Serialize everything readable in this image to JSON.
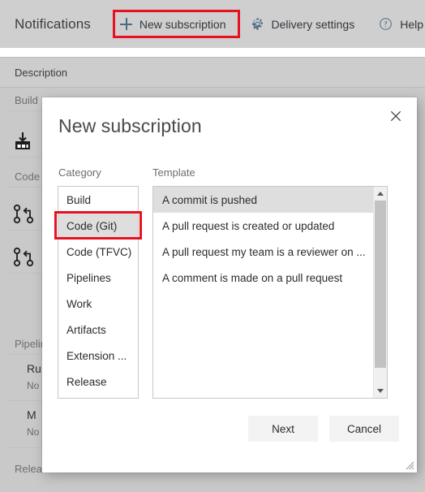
{
  "background": {
    "toolbar": {
      "title": "Notifications",
      "items": [
        {
          "label": "New subscription",
          "icon": "plus-icon",
          "highlighted": true
        },
        {
          "label": "Delivery settings",
          "icon": "gear-icon",
          "highlighted": false
        },
        {
          "label": "Help",
          "icon": "help-circle-icon",
          "highlighted": false
        }
      ]
    },
    "column_header": "Description",
    "groups": [
      {
        "label": "Build"
      },
      {
        "label": "Code"
      },
      {
        "label": "Pipelines"
      },
      {
        "label": "Release"
      }
    ],
    "rows": [
      {
        "primary": "Ru",
        "secondary": "No"
      },
      {
        "primary": "M",
        "secondary": "No"
      }
    ]
  },
  "dialog": {
    "title": "New subscription",
    "close_label": "✕",
    "category": {
      "label": "Category",
      "items": [
        "Build",
        "Code (Git)",
        "Code (TFVC)",
        "Pipelines",
        "Work",
        "Artifacts",
        "Extension ...",
        "Release"
      ],
      "selected_index": 1
    },
    "template": {
      "label": "Template",
      "items": [
        "A commit is pushed",
        "A pull request is created or updated",
        "A pull request my team is a reviewer on ...",
        "A comment is made on a pull request"
      ],
      "selected_index": 0
    },
    "buttons": {
      "primary": "Next",
      "secondary": "Cancel"
    }
  },
  "colors": {
    "annotation_red": "#e81123",
    "accent_blue": "#4a6b86",
    "selection_gray": "#dedede",
    "overlay_gray": "#c9c9c9"
  }
}
